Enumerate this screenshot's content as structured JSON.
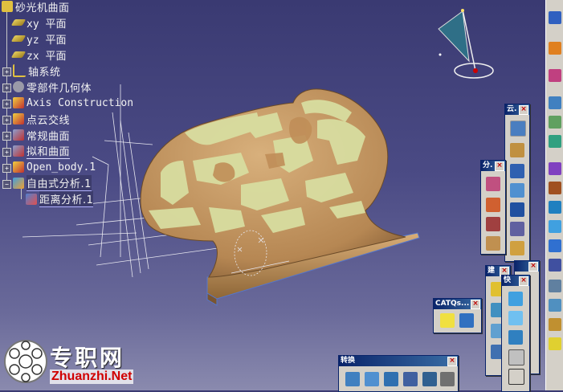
{
  "app": "CATIA",
  "tree": {
    "root_label": "砂光机曲面",
    "items": [
      {
        "label": "xy 平面"
      },
      {
        "label": "yz 平面"
      },
      {
        "label": "zx 平面"
      },
      {
        "label": "轴系统"
      },
      {
        "label": "零部件几何体"
      },
      {
        "label": "Axis Construction"
      },
      {
        "label": "点云交线"
      },
      {
        "label": "常规曲面"
      },
      {
        "label": "拟和曲面"
      },
      {
        "label": "Open_body.1"
      },
      {
        "label": "自由式分析.1"
      },
      {
        "label": "距离分析.1"
      }
    ]
  },
  "toolbars": {
    "cloud": {
      "title": "云."
    },
    "analysis": {
      "title": "分."
    },
    "build": {
      "title": "建"
    },
    "quick": {
      "title": "快"
    },
    "catqs": {
      "title": "CATQs..."
    },
    "convert": {
      "title": "转换"
    }
  },
  "watermark": {
    "cn": "专职网",
    "en": "Zhuanzhi.Net"
  },
  "colors": {
    "background_top": "#3a3a72",
    "background_bottom": "#8a8aae",
    "surface_tan": "#c49a66",
    "surface_green": "#d8dda0",
    "toolbar_grey": "#d4d0c8",
    "titlebar_blue": "#0a246a"
  },
  "icons": {
    "compass": "compass-icon",
    "close": "close-icon"
  }
}
